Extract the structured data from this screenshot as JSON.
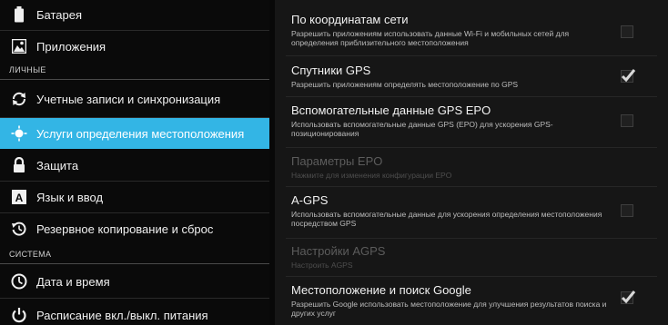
{
  "sidebar": {
    "items": [
      {
        "label": "Батарея",
        "icon": "battery-icon"
      },
      {
        "label": "Приложения",
        "icon": "apps-icon"
      },
      {
        "label": "Учетные записи и синхронизация",
        "icon": "sync-icon"
      },
      {
        "label": "Услуги определения местоположения",
        "icon": "location-icon",
        "selected": true
      },
      {
        "label": "Защита",
        "icon": "lock-icon"
      },
      {
        "label": "Язык и ввод",
        "icon": "language-icon"
      },
      {
        "label": "Резервное копирование и сброс",
        "icon": "backup-icon"
      },
      {
        "label": "Дата и время",
        "icon": "clock-icon"
      },
      {
        "label": "Расписание вкл./выкл. питания",
        "icon": "power-icon"
      }
    ],
    "section_personal": "ЛИЧНЫЕ",
    "section_system": "СИСТЕМА"
  },
  "location_settings": {
    "items": [
      {
        "title": "По координатам сети",
        "summary": "Разрешить приложениям использовать данные Wi-Fi и мобильных сетей для определения приблизительного местоположения",
        "checked": false,
        "enabled": true
      },
      {
        "title": "Спутники GPS",
        "summary": "Разрешить приложениям определять местоположение по GPS",
        "checked": true,
        "enabled": true
      },
      {
        "title": "Вспомогательные данные GPS EPO",
        "summary": "Использовать вспомогательные данные GPS (EPO) для ускорения GPS-позиционирования",
        "checked": false,
        "enabled": true
      },
      {
        "title": "Параметры EPO",
        "summary": "Нажмите для изменения конфигурации EPO",
        "enabled": false
      },
      {
        "title": "A-GPS",
        "summary": "Использовать вспомогательные данные для ускорения определения местоположения посредством GPS",
        "checked": false,
        "enabled": true
      },
      {
        "title": "Настройки AGPS",
        "summary": "Настроить AGPS",
        "enabled": false
      },
      {
        "title": "Местоположение и поиск Google",
        "summary": "Разрешить Google использовать местоположение для улучшения результатов поиска и других услуг",
        "checked": true,
        "enabled": true
      }
    ]
  },
  "colors": {
    "accent": "#33b5e5",
    "check": "#d8d8d8"
  }
}
